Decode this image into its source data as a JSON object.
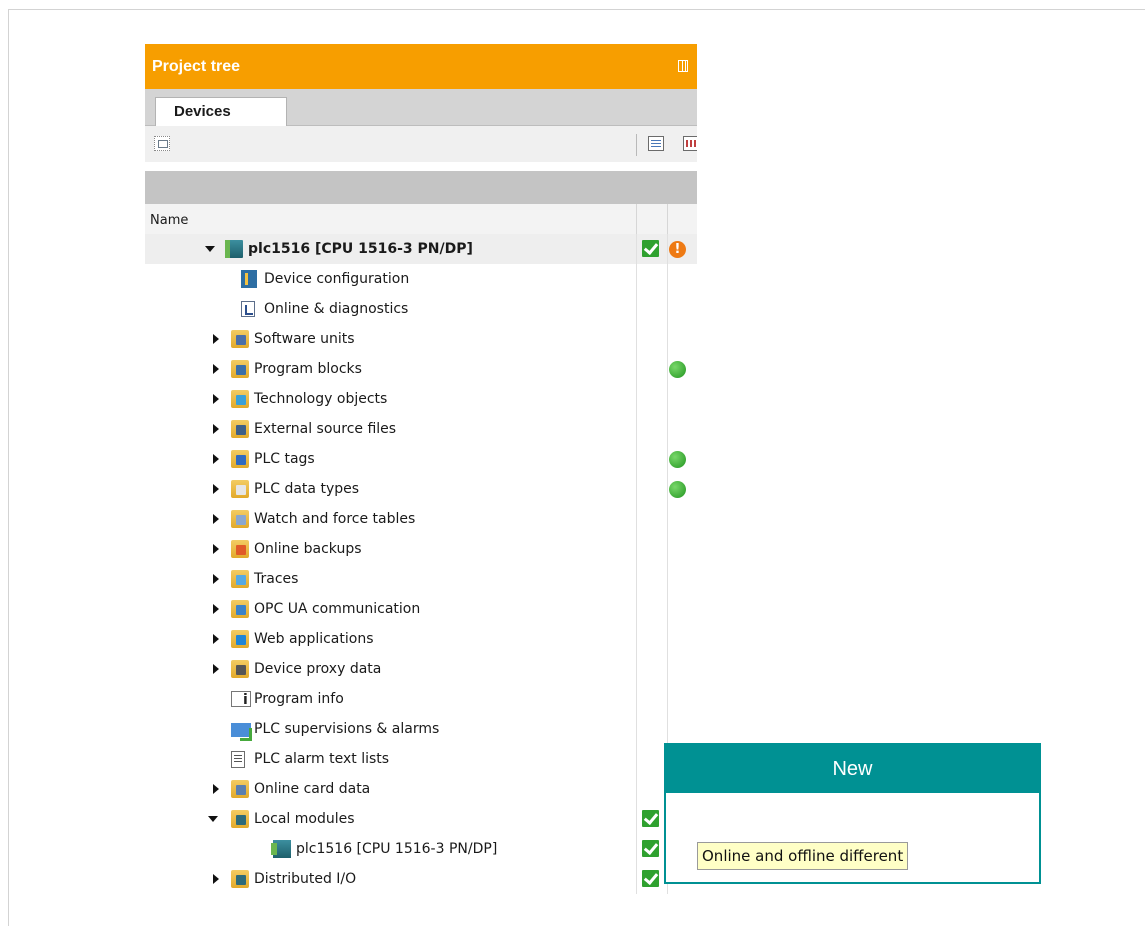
{
  "panel": {
    "title": "Project tree",
    "tab": "Devices",
    "column_name": "Name"
  },
  "tree": [
    {
      "label": "plc1516 [CPU 1516-3 PN/DP]",
      "icon": "plc-station-icon",
      "arrow": "expanded",
      "status_check": true,
      "status_icon": "warning"
    },
    {
      "label": "Device configuration",
      "icon": "device-configuration-icon",
      "arrow": "none",
      "status_check": false,
      "status_icon": ""
    },
    {
      "label": "Online & diagnostics",
      "icon": "online-diagnostics-icon",
      "arrow": "none",
      "status_check": false,
      "status_icon": ""
    },
    {
      "label": "Software units",
      "icon": "software-units-folder-icon",
      "arrow": "collapsed",
      "status_check": false,
      "status_icon": ""
    },
    {
      "label": "Program blocks",
      "icon": "program-blocks-folder-icon",
      "arrow": "collapsed",
      "status_check": false,
      "status_icon": "green"
    },
    {
      "label": "Technology objects",
      "icon": "technology-objects-folder-icon",
      "arrow": "collapsed",
      "status_check": false,
      "status_icon": ""
    },
    {
      "label": "External source files",
      "icon": "external-source-files-folder-icon",
      "arrow": "collapsed",
      "status_check": false,
      "status_icon": ""
    },
    {
      "label": "PLC tags",
      "icon": "plc-tags-folder-icon",
      "arrow": "collapsed",
      "status_check": false,
      "status_icon": "green"
    },
    {
      "label": "PLC data types",
      "icon": "plc-data-types-folder-icon",
      "arrow": "collapsed",
      "status_check": false,
      "status_icon": "green"
    },
    {
      "label": "Watch and force tables",
      "icon": "watch-force-tables-folder-icon",
      "arrow": "collapsed",
      "status_check": false,
      "status_icon": ""
    },
    {
      "label": "Online backups",
      "icon": "online-backups-folder-icon",
      "arrow": "collapsed",
      "status_check": false,
      "status_icon": ""
    },
    {
      "label": "Traces",
      "icon": "traces-folder-icon",
      "arrow": "collapsed",
      "status_check": false,
      "status_icon": ""
    },
    {
      "label": "OPC UA communication",
      "icon": "opc-ua-folder-icon",
      "arrow": "collapsed",
      "status_check": false,
      "status_icon": ""
    },
    {
      "label": "Web applications",
      "icon": "web-applications-folder-icon",
      "arrow": "collapsed",
      "status_check": false,
      "status_icon": ""
    },
    {
      "label": "Device proxy data",
      "icon": "device-proxy-data-folder-icon",
      "arrow": "collapsed",
      "status_check": false,
      "status_icon": ""
    },
    {
      "label": "Program info",
      "icon": "program-info-icon",
      "arrow": "none",
      "status_check": false,
      "status_icon": ""
    },
    {
      "label": "PLC supervisions & alarms",
      "icon": "plc-supervisions-alarms-icon",
      "arrow": "none",
      "status_check": false,
      "status_icon": ""
    },
    {
      "label": "PLC alarm text lists",
      "icon": "alarm-text-lists-icon",
      "arrow": "none",
      "status_check": false,
      "status_icon": ""
    },
    {
      "label": "Online card data",
      "icon": "online-card-data-folder-icon",
      "arrow": "collapsed",
      "status_check": false,
      "status_icon": ""
    },
    {
      "label": "Local modules",
      "icon": "local-modules-folder-icon",
      "arrow": "expanded",
      "status_check": true,
      "status_icon": "warning"
    },
    {
      "label": "plc1516 [CPU 1516-3 PN/DP]",
      "icon": "cpu-module-icon",
      "arrow": "none",
      "status_check": true,
      "status_icon": "online-offline-different"
    },
    {
      "label": "Distributed I/O",
      "icon": "distributed-io-folder-icon",
      "arrow": "collapsed",
      "status_check": true,
      "status_icon": ""
    }
  ],
  "callout": {
    "title": "New"
  },
  "tooltip": {
    "text": "Online and offline different"
  },
  "colors": {
    "title_bar": "#f79e00",
    "callout": "#009193",
    "check": "#2fa12f",
    "warning": "#ee7a14",
    "ok_dot": "#21941f",
    "tooltip_bg": "#ffffc6"
  }
}
